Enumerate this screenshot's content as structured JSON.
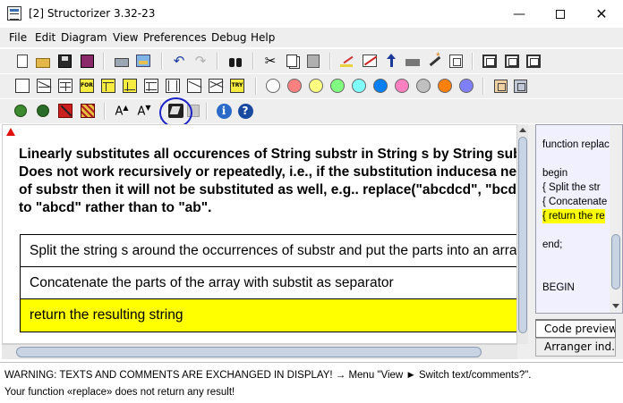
{
  "window": {
    "title": "[2] Structorizer 3.32-23",
    "min_glyph": "—",
    "close_glyph": "✕"
  },
  "menubar": {
    "items": [
      "File",
      "Edit",
      "Diagram",
      "View",
      "Preferences",
      "Debug",
      "Help"
    ]
  },
  "toolbar_row1": [
    "new-diagram-icon",
    "open-folder-icon",
    "save-icon",
    "save-all-icon",
    "print-icon",
    "export-image-icon",
    "undo-icon",
    "redo-icon",
    "find-icon",
    "cut-icon",
    "copy-icon",
    "paste-icon",
    "edit-element-icon",
    "delete-element-icon",
    "move-up-icon",
    "move-down-icon",
    "transmute-icon",
    "outsource-icon",
    "collapse-icon",
    "expand-icon",
    "toggle-box-icon"
  ],
  "toolbar_row2": {
    "elements": [
      "instruction-element-icon",
      "alternative-element-icon",
      "case-element-icon",
      "for-loop-element-icon",
      "while-loop-element-icon",
      "repeat-loop-element-icon",
      "forever-loop-element-icon",
      "call-element-icon",
      "jump-element-icon",
      "parallel-element-icon",
      "try-element-icon"
    ],
    "for_tag": "FOR",
    "try_tag": "TRY",
    "colors": [
      "#ffffff",
      "#ff8080",
      "#ffff80",
      "#80ff80",
      "#80ffff",
      "#0080ff",
      "#ff80c0",
      "#c0c0c0",
      "#ff8000",
      "#8080ff"
    ]
  },
  "toolbar_row3": {
    "font_larger_label": "A",
    "font_smaller_label": "A",
    "items": [
      "debug-bug-icon",
      "stop-debug-icon",
      "breakpoint-icon",
      "font-larger-icon",
      "font-smaller-icon",
      "switch-text-comments-icon",
      "comments-popup-icon",
      "about-info-icon",
      "help-icon"
    ]
  },
  "diagram": {
    "comment_lines": [
      "Linearly substitutes all occurences of String substr in String s by String subst",
      "Does not work recursively or repeatedly, i.e., if the substitution inducesa new",
      "of substr then it will not be substituted as well, e.g.. replace(\"abcdcd\", \"bcd\",",
      "to \"abcd\" rather than to \"ab\"."
    ],
    "elements": [
      "Split the string s around the occurrences of substr and put the parts into an array",
      "Concatenate the parts of the array with substit as separator",
      "return the resulting string"
    ]
  },
  "code_preview": {
    "lines": [
      "function replace(",
      "",
      "begin",
      "  { Split the str",
      "  { Concatenate",
      "  { return the re",
      "",
      "end;",
      "",
      "",
      "BEGIN"
    ],
    "highlighted_line": 5
  },
  "tabs": {
    "code_preview": "Code preview",
    "arranger": "Arranger ind..."
  },
  "status": {
    "line1": "WARNING: TEXTS AND COMMENTS ARE EXCHANGED IN DISPLAY! → Menu \"View ► Switch text/comments?\".",
    "line2": "Your function «replace» does not return any result!"
  }
}
